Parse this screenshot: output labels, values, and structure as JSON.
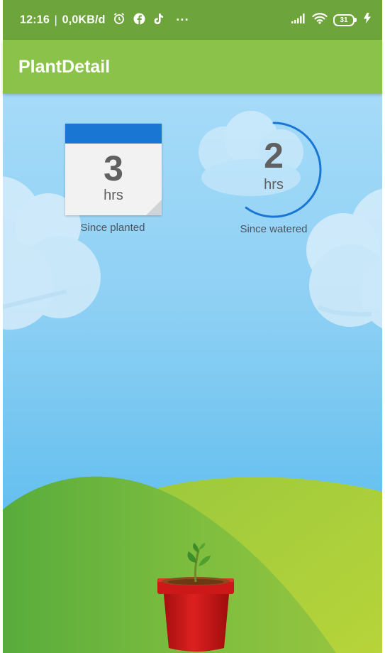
{
  "status_bar": {
    "time": "12:16",
    "separator": "|",
    "data_rate": "0,0KB/d",
    "more_dots": "···",
    "battery_level": "31",
    "icons": [
      "alarm-icon",
      "facebook-icon",
      "tiktok-icon",
      "signal-icon",
      "wifi-icon",
      "battery-icon",
      "charging-icon"
    ]
  },
  "app_bar": {
    "title": "PlantDetail"
  },
  "planted": {
    "value": "3",
    "unit": "hrs",
    "label": "Since planted"
  },
  "watered": {
    "value": "2",
    "unit": "hrs",
    "label": "Since watered",
    "progress": 0.6
  },
  "colors": {
    "status_bar": "#6ea43c",
    "app_bar": "#8bc34a",
    "accent_blue": "#1976d2",
    "sky": "#8ccff4",
    "grass": "#8cc63f",
    "pot": "#d01c1c"
  }
}
